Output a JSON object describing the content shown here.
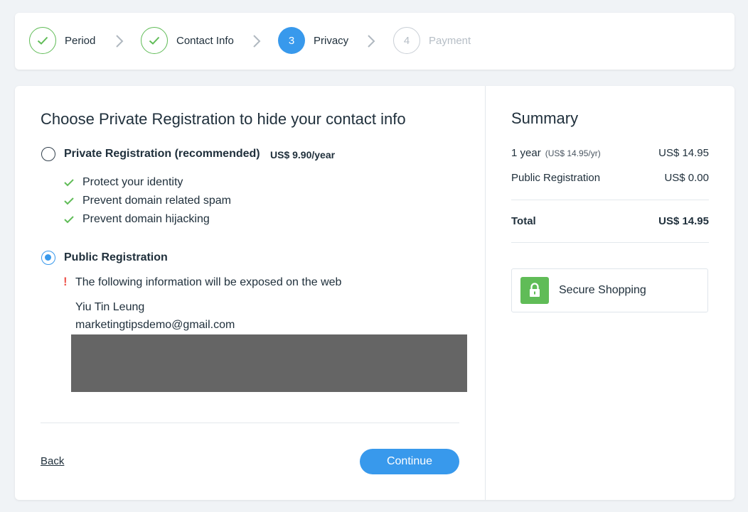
{
  "steps": [
    {
      "number": "1",
      "label": "Period",
      "state": "done"
    },
    {
      "number": "2",
      "label": "Contact Info",
      "state": "done"
    },
    {
      "number": "3",
      "label": "Privacy",
      "state": "active"
    },
    {
      "number": "4",
      "label": "Payment",
      "state": "pending"
    }
  ],
  "privacy": {
    "heading": "Choose Private Registration to hide your contact info",
    "private_option": {
      "label": "Private Registration (recommended)",
      "price": "US$ 9.90/year",
      "selected": false,
      "benefits": [
        "Protect your identity",
        "Prevent domain related spam",
        "Prevent domain hijacking"
      ]
    },
    "public_option": {
      "label": "Public Registration",
      "selected": true,
      "warning_icon": "!",
      "warning": "The following information will be exposed on the web",
      "name": "Yiu Tin Leung",
      "email": "marketingtipsdemo@gmail.com"
    },
    "back_label": "Back",
    "continue_label": "Continue"
  },
  "summary": {
    "title": "Summary",
    "rows": [
      {
        "label": "1 year",
        "sub": "(US$ 14.95/yr)",
        "value": "US$ 14.95"
      },
      {
        "label": "Public Registration",
        "sub": "",
        "value": "US$ 0.00"
      }
    ],
    "total_label": "Total",
    "total_value": "US$ 14.95",
    "secure_label": "Secure Shopping"
  },
  "colors": {
    "accent": "#3899ec",
    "success": "#60bc57",
    "warning": "#ee5951",
    "redacted": "#656565"
  }
}
